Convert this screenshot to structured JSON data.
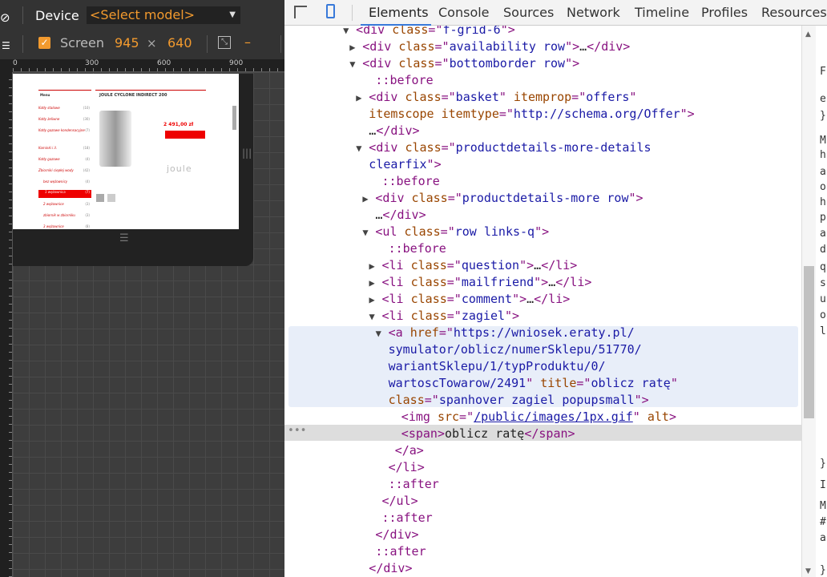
{
  "device_toolbar": {
    "device_label": "Device",
    "model_select": "<Select model>",
    "screen_label": "Screen",
    "width": "945",
    "times": "×",
    "height": "640",
    "dash": "–",
    "ruler_ticks": [
      "0",
      "300",
      "600",
      "900"
    ]
  },
  "preview": {
    "menu_title": "Menu",
    "product_title": "JOULE CYCLONE INDIRECT 200",
    "price": "2 491,00 zł",
    "brand": "joule",
    "menu_items": [
      "Kotły stalowe",
      "Kotły żeliwne",
      "Kotły gazowe kondensacyjne",
      "Kominki i il.",
      "Kotły gazowe",
      "Zbiorniki ciepłej wody",
      "bez wężownicy",
      "1 wężownica",
      "2 wężownice",
      "zbiornik w zbiorniku",
      "3 wężownice"
    ]
  },
  "devtools": {
    "tabs": [
      "Elements",
      "Console",
      "Sources",
      "Network",
      "Timeline",
      "Profiles",
      "Resources"
    ],
    "active_tab": "Elements",
    "icons": [
      "inspect-icon",
      "device-mode-icon"
    ]
  },
  "dom_lines": [
    {
      "indent": 11,
      "tri": "▼",
      "parts": [
        [
          "tag",
          "<div "
        ],
        [
          "an",
          "class"
        ],
        [
          "tag",
          "=\""
        ],
        [
          "av",
          "f-grid-6"
        ],
        [
          "tag",
          "\">"
        ]
      ]
    },
    {
      "indent": 12,
      "tri": "▶",
      "parts": [
        [
          "tag",
          "<div "
        ],
        [
          "an",
          "class"
        ],
        [
          "tag",
          "=\""
        ],
        [
          "av",
          "availability row"
        ],
        [
          "tag",
          "\">"
        ],
        [
          "txt",
          "…"
        ],
        [
          "tag",
          "</div>"
        ]
      ]
    },
    {
      "indent": 12,
      "tri": "▼",
      "parts": [
        [
          "tag",
          "<div "
        ],
        [
          "an",
          "class"
        ],
        [
          "tag",
          "=\""
        ],
        [
          "av",
          "bottomborder row"
        ],
        [
          "tag",
          "\">"
        ]
      ]
    },
    {
      "indent": 14,
      "tri": "",
      "parts": [
        [
          "ps",
          "::before"
        ]
      ]
    },
    {
      "indent": 13,
      "tri": "▶",
      "parts": [
        [
          "tag",
          "<div "
        ],
        [
          "an",
          "class"
        ],
        [
          "tag",
          "=\""
        ],
        [
          "av",
          "basket"
        ],
        [
          "tag",
          "\" "
        ],
        [
          "an",
          "itemprop"
        ],
        [
          "tag",
          "=\""
        ],
        [
          "av",
          "offers"
        ],
        [
          "tag",
          "\""
        ]
      ]
    },
    {
      "indent": 13,
      "tri": "",
      "parts": [
        [
          "an",
          "itemscope itemtype"
        ],
        [
          "tag",
          "=\""
        ],
        [
          "av",
          "http://schema.org/Offer"
        ],
        [
          "tag",
          "\">"
        ]
      ]
    },
    {
      "indent": 13,
      "tri": "",
      "parts": [
        [
          "txt",
          "…"
        ],
        [
          "tag",
          "</div>"
        ]
      ]
    },
    {
      "indent": 13,
      "tri": "▼",
      "parts": [
        [
          "tag",
          "<div "
        ],
        [
          "an",
          "class"
        ],
        [
          "tag",
          "=\""
        ],
        [
          "av",
          "productdetails-more-details"
        ]
      ]
    },
    {
      "indent": 13,
      "tri": "",
      "parts": [
        [
          "av",
          "clearfix"
        ],
        [
          "tag",
          "\">"
        ]
      ]
    },
    {
      "indent": 15,
      "tri": "",
      "parts": [
        [
          "ps",
          "::before"
        ]
      ]
    },
    {
      "indent": 14,
      "tri": "▶",
      "parts": [
        [
          "tag",
          "<div "
        ],
        [
          "an",
          "class"
        ],
        [
          "tag",
          "=\""
        ],
        [
          "av",
          "productdetails-more row"
        ],
        [
          "tag",
          "\">"
        ]
      ]
    },
    {
      "indent": 14,
      "tri": "",
      "parts": [
        [
          "txt",
          "…"
        ],
        [
          "tag",
          "</div>"
        ]
      ]
    },
    {
      "indent": 14,
      "tri": "▼",
      "parts": [
        [
          "tag",
          "<ul "
        ],
        [
          "an",
          "class"
        ],
        [
          "tag",
          "=\""
        ],
        [
          "av",
          "row links-q"
        ],
        [
          "tag",
          "\">"
        ]
      ]
    },
    {
      "indent": 16,
      "tri": "",
      "parts": [
        [
          "ps",
          "::before"
        ]
      ]
    },
    {
      "indent": 15,
      "tri": "▶",
      "parts": [
        [
          "tag",
          "<li "
        ],
        [
          "an",
          "class"
        ],
        [
          "tag",
          "=\""
        ],
        [
          "av",
          "question"
        ],
        [
          "tag",
          "\">"
        ],
        [
          "txt",
          "…"
        ],
        [
          "tag",
          "</li>"
        ]
      ]
    },
    {
      "indent": 15,
      "tri": "▶",
      "parts": [
        [
          "tag",
          "<li "
        ],
        [
          "an",
          "class"
        ],
        [
          "tag",
          "=\""
        ],
        [
          "av",
          "mailfriend"
        ],
        [
          "tag",
          "\">"
        ],
        [
          "txt",
          "…"
        ],
        [
          "tag",
          "</li>"
        ]
      ]
    },
    {
      "indent": 15,
      "tri": "▶",
      "parts": [
        [
          "tag",
          "<li "
        ],
        [
          "an",
          "class"
        ],
        [
          "tag",
          "=\""
        ],
        [
          "av",
          "comment"
        ],
        [
          "tag",
          "\">"
        ],
        [
          "txt",
          "…"
        ],
        [
          "tag",
          "</li>"
        ]
      ]
    },
    {
      "indent": 15,
      "tri": "▼",
      "parts": [
        [
          "tag",
          "<li "
        ],
        [
          "an",
          "class"
        ],
        [
          "tag",
          "=\""
        ],
        [
          "av",
          "zagiel"
        ],
        [
          "tag",
          "\">"
        ]
      ]
    },
    {
      "indent": 16,
      "tri": "▼",
      "parts": [
        [
          "tag",
          "<a "
        ],
        [
          "an",
          "href"
        ],
        [
          "tag",
          "=\""
        ],
        [
          "av",
          "https://wniosek.eraty.pl/"
        ]
      ]
    },
    {
      "indent": 16,
      "tri": "",
      "parts": [
        [
          "av",
          "symulator/oblicz/numerSklepu/51770/"
        ]
      ]
    },
    {
      "indent": 16,
      "tri": "",
      "parts": [
        [
          "av",
          "wariantSklepu/1/typProduktu/0/"
        ]
      ]
    },
    {
      "indent": 16,
      "tri": "",
      "parts": [
        [
          "av",
          "wartoscTowarow/2491"
        ],
        [
          "tag",
          "\" "
        ],
        [
          "an",
          "title"
        ],
        [
          "tag",
          "=\""
        ],
        [
          "av",
          "oblicz ratę"
        ],
        [
          "tag",
          "\""
        ]
      ]
    },
    {
      "indent": 16,
      "tri": "",
      "parts": [
        [
          "an",
          "class"
        ],
        [
          "tag",
          "=\""
        ],
        [
          "av",
          "spanhover zagiel popupsmall"
        ],
        [
          "tag",
          "\">"
        ]
      ]
    },
    {
      "indent": 18,
      "tri": "",
      "parts": [
        [
          "tag",
          "<img "
        ],
        [
          "an",
          "src"
        ],
        [
          "tag",
          "=\""
        ],
        [
          "link",
          "/public/images/1px.gif"
        ],
        [
          "tag",
          "\" "
        ],
        [
          "an",
          "alt"
        ],
        [
          "tag",
          ">"
        ]
      ]
    },
    {
      "indent": 18,
      "tri": "",
      "parts": [
        [
          "tag",
          "<span>"
        ],
        [
          "txt",
          "oblicz ratę"
        ],
        [
          "tag",
          "</span>"
        ]
      ]
    },
    {
      "indent": 17,
      "tri": "",
      "parts": [
        [
          "tag",
          "</a>"
        ]
      ]
    },
    {
      "indent": 16,
      "tri": "",
      "parts": [
        [
          "tag",
          "</li>"
        ]
      ]
    },
    {
      "indent": 16,
      "tri": "",
      "parts": [
        [
          "ps",
          "::after"
        ]
      ]
    },
    {
      "indent": 15,
      "tri": "",
      "parts": [
        [
          "tag",
          "</ul>"
        ]
      ]
    },
    {
      "indent": 15,
      "tri": "",
      "parts": [
        [
          "ps",
          "::after"
        ]
      ]
    },
    {
      "indent": 14,
      "tri": "",
      "parts": [
        [
          "tag",
          "</div>"
        ]
      ]
    },
    {
      "indent": 14,
      "tri": "",
      "parts": [
        [
          "ps",
          "::after"
        ]
      ]
    },
    {
      "indent": 13,
      "tri": "",
      "parts": [
        [
          "tag",
          "</div>"
        ]
      ]
    }
  ],
  "side_chars": [
    "F",
    "e",
    "}",
    "M",
    "h",
    "a",
    "o",
    "h",
    "p",
    "a",
    "d",
    "q",
    "s",
    "u",
    "o",
    "l",
    "}",
    "I",
    "M",
    "#",
    "a",
    "}"
  ],
  "colors": {
    "accent": "#f29a2e",
    "tab_active": "#3879d9",
    "tag": "#881280",
    "attr_name": "#994500",
    "attr_value": "#1a1aa6"
  }
}
